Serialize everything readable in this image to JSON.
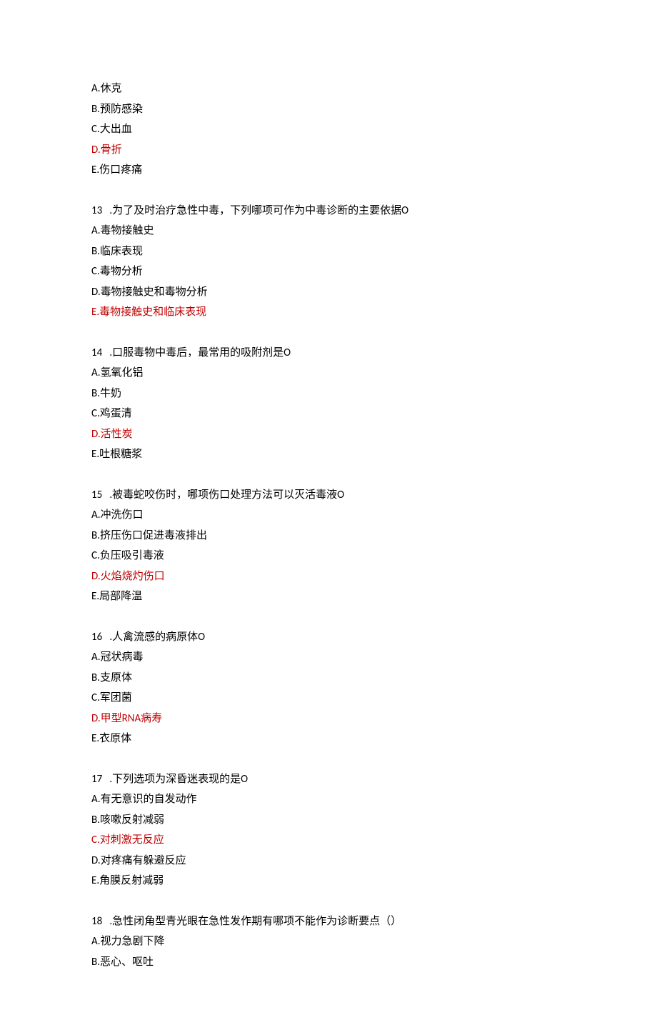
{
  "block0": {
    "options": [
      {
        "text": "A.休克",
        "red": false
      },
      {
        "text": "B.预防感染",
        "red": false
      },
      {
        "text": "C.大出血",
        "red": false
      },
      {
        "text": "D.骨折",
        "red": true
      },
      {
        "text": "E.伤口疼痛",
        "red": false
      }
    ]
  },
  "q13": {
    "stem": "13   .为了及时治疗急性中毒，下列哪项可作为中毒诊断的主要依据O",
    "options": [
      {
        "text": "A.毒物接触史",
        "red": false
      },
      {
        "text": "B.临床表现",
        "red": false
      },
      {
        "text": "C.毒物分析",
        "red": false
      },
      {
        "text": "D.毒物接触史和毒物分析",
        "red": false
      },
      {
        "text": "E.毒物接触史和临床表现",
        "red": true
      }
    ]
  },
  "q14": {
    "stem": "14   .口服毒物中毒后，最常用的吸附剂是O",
    "options": [
      {
        "text": "A.氢氧化铝",
        "red": false
      },
      {
        "text": "B.牛奶",
        "red": false
      },
      {
        "text": "C.鸡蛋清",
        "red": false
      },
      {
        "text": "D.活性炭",
        "red": true
      },
      {
        "text": "E.吐根糖浆",
        "red": false
      }
    ]
  },
  "q15": {
    "stem": "15   .被毒蛇咬伤时，哪项伤口处理方法可以灭活毒液O",
    "options": [
      {
        "text": "A.冲洗伤口",
        "red": false
      },
      {
        "text": "B.挤压伤口促进毒液排出",
        "red": false
      },
      {
        "text": "C.负压吸引毒液",
        "red": false
      },
      {
        "text": "D.火焰烧灼伤口",
        "red": true
      },
      {
        "text": "E.局部降温",
        "red": false
      }
    ]
  },
  "q16": {
    "stem": "16   .人禽流感的病原体O",
    "options": [
      {
        "text": "A.冠状病毒",
        "red": false
      },
      {
        "text": "B.支原体",
        "red": false
      },
      {
        "text": "C.军团菌",
        "red": false
      },
      {
        "text": "D.甲型RNA病寿",
        "red": true
      },
      {
        "text": "E.衣原体",
        "red": false
      }
    ]
  },
  "q17": {
    "stem": "17   .下列选项为深昏迷表现的是O",
    "options": [
      {
        "text": "A.有无意识的自发动作",
        "red": false
      },
      {
        "text": "B.咳嗽反射减弱",
        "red": false
      },
      {
        "text": "C.对刺激无反应",
        "red": true
      },
      {
        "text": "D.对疼痛有躲避反应",
        "red": false
      },
      {
        "text": "E.角膜反射减弱",
        "red": false
      }
    ]
  },
  "q18": {
    "stem": "18   .急性闭角型青光眼在急性发作期有哪项不能作为诊断要点（）",
    "options": [
      {
        "text": "A.视力急剧下降",
        "red": false
      },
      {
        "text": "B.恶心、呕吐",
        "red": false
      }
    ]
  }
}
